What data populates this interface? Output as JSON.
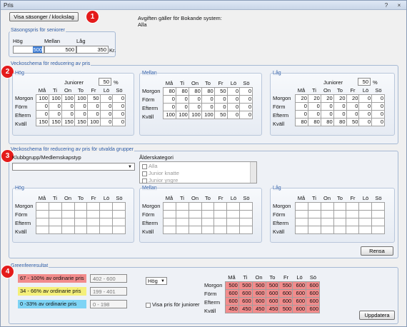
{
  "window": {
    "title": "Pris",
    "help": "?",
    "close": "×"
  },
  "top": {
    "seasons_button": "Visa säsonger / klockslag",
    "fee_title": "Avgiften gäller för Bokande system:",
    "fee_value": "Alla"
  },
  "badges": [
    "1",
    "2",
    "3",
    "4"
  ],
  "senior": {
    "legend": "Säsongspris för seniorer",
    "labels": [
      "Hög",
      "Mellan",
      "Låg"
    ],
    "values": [
      "500",
      "500",
      "350"
    ],
    "unit": "Kr."
  },
  "weekly": {
    "legend": "Veckoschema för reducering av pris",
    "junior_label": "Juniorer",
    "percent": "%",
    "days": [
      "Må",
      "Ti",
      "On",
      "To",
      "Fr",
      "Lö",
      "Sö"
    ],
    "rows": [
      "Morgon",
      "Förm",
      "Efterm",
      "Kväll"
    ],
    "panels": [
      {
        "label": "Hög",
        "junior": "50",
        "data": [
          [
            "100",
            "100",
            "100",
            "100",
            "50",
            "0",
            "0"
          ],
          [
            "0",
            "0",
            "0",
            "0",
            "0",
            "0",
            "0"
          ],
          [
            "0",
            "0",
            "0",
            "0",
            "0",
            "0",
            "0"
          ],
          [
            "150",
            "150",
            "150",
            "150",
            "100",
            "0",
            "0"
          ]
        ]
      },
      {
        "label": "Mellan",
        "junior": "",
        "data": [
          [
            "80",
            "80",
            "80",
            "80",
            "50",
            "0",
            "0"
          ],
          [
            "0",
            "0",
            "0",
            "0",
            "0",
            "0",
            "0"
          ],
          [
            "0",
            "0",
            "0",
            "0",
            "0",
            "0",
            "0"
          ],
          [
            "100",
            "100",
            "100",
            "100",
            "50",
            "0",
            "0"
          ]
        ]
      },
      {
        "label": "Låg",
        "junior": "50",
        "data": [
          [
            "20",
            "20",
            "20",
            "20",
            "20",
            "0",
            "0"
          ],
          [
            "0",
            "0",
            "0",
            "0",
            "0",
            "0",
            "0"
          ],
          [
            "0",
            "0",
            "0",
            "0",
            "0",
            "0",
            "0"
          ],
          [
            "80",
            "80",
            "80",
            "80",
            "50",
            "0",
            "0"
          ]
        ]
      }
    ]
  },
  "groups": {
    "legend": "Veckoschema för reducering av pris för utvalda grupper",
    "club_label": "Klubbgrupp/Medlemskapstyp",
    "age_label": "Ålderskategori",
    "age_items": [
      "Alla",
      "Junior knatte",
      "Junior yngre"
    ],
    "panels": [
      "Hög",
      "Mellan",
      "Låg"
    ],
    "clear_button": "Rensa"
  },
  "result": {
    "legend": "Greenfeeresultat",
    "ranges": [
      {
        "label": "67 - 100% av ordinarie pris",
        "value": "402 - 600",
        "color": "#f28c8c"
      },
      {
        "label": "34 - 66% av ordinarie pris",
        "value": "199 - 401",
        "color": "#f5f07a"
      },
      {
        "label": "0 -33% av ordinarie pris",
        "value": "0 - 198",
        "color": "#7ed4f5"
      }
    ],
    "select_value": "Hög",
    "junior_checkbox": "Visa pris för juniorer",
    "update_button": "Uppdatera",
    "data": [
      [
        "500",
        "500",
        "500",
        "500",
        "550",
        "600",
        "600"
      ],
      [
        "600",
        "600",
        "600",
        "600",
        "600",
        "600",
        "600"
      ],
      [
        "600",
        "600",
        "600",
        "600",
        "600",
        "600",
        "600"
      ],
      [
        "450",
        "450",
        "450",
        "450",
        "500",
        "600",
        "600"
      ]
    ]
  }
}
